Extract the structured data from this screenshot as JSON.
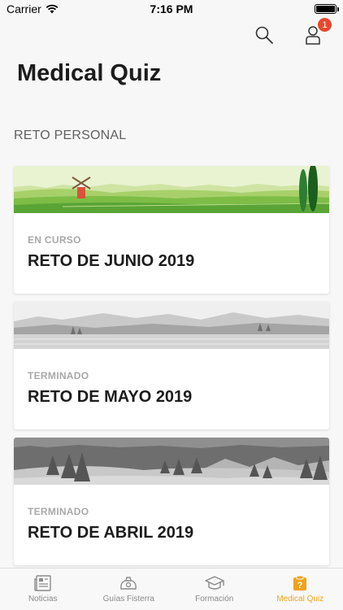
{
  "status_bar": {
    "carrier": "Carrier",
    "time": "7:16 PM"
  },
  "header": {
    "notification_count": "1",
    "title": "Medical Quiz"
  },
  "section": {
    "title": "RETO PERSONAL"
  },
  "cards": [
    {
      "status": "EN CURSO",
      "title": "RETO DE JUNIO 2019"
    },
    {
      "status": "TERMINADO",
      "title": "RETO DE MAYO 2019"
    },
    {
      "status": "TERMINADO",
      "title": "RETO DE ABRIL 2019"
    }
  ],
  "tabs": [
    {
      "label": "Noticias",
      "icon": "news-icon"
    },
    {
      "label": "Guías Fisterra",
      "icon": "stethoscope-icon"
    },
    {
      "label": "Formación",
      "icon": "graduation-cap-icon"
    },
    {
      "label": "Medical Quiz",
      "icon": "quiz-icon"
    }
  ],
  "colors": {
    "accent": "#f0a21a",
    "badge": "#e5482d"
  }
}
